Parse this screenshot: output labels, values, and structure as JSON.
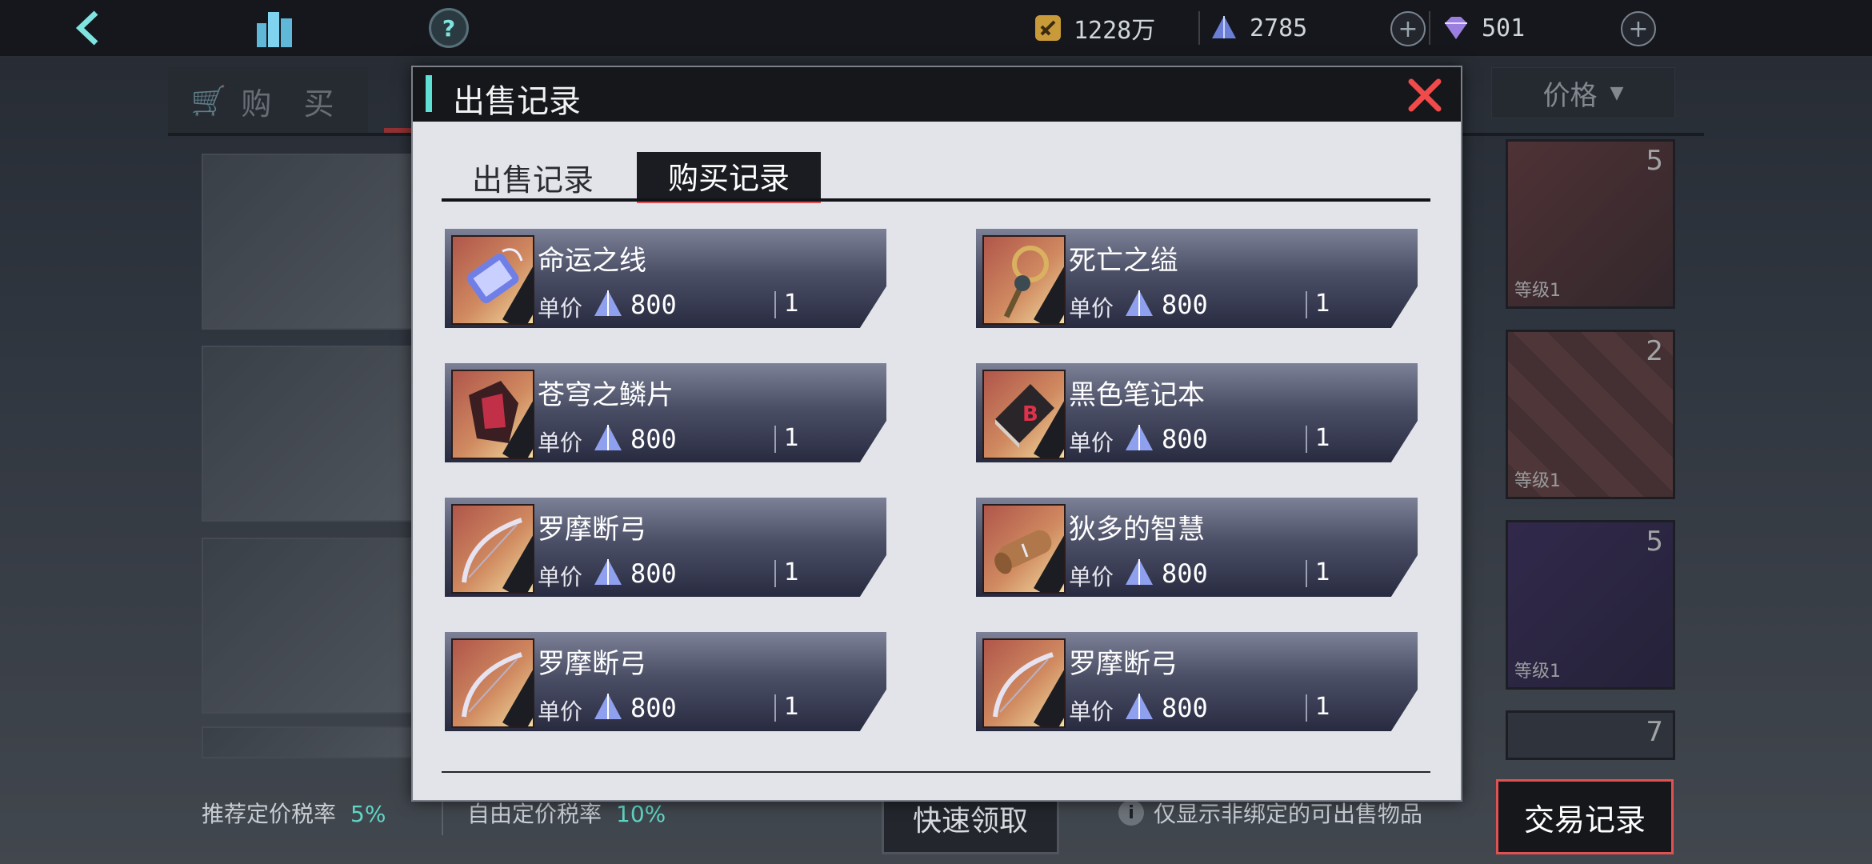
{
  "currencies": {
    "gold": "1228万",
    "crystal": "2785",
    "gem": "501"
  },
  "background": {
    "buy_tab": "购 买",
    "price_sort": "价格",
    "right_cards": [
      {
        "count": "5",
        "level": "等级1"
      },
      {
        "count": "2",
        "level": "等级1"
      },
      {
        "count": "5",
        "level": "等级1"
      },
      {
        "count": "7",
        "level": ""
      }
    ],
    "recommended_tax_label": "推荐定价税率",
    "recommended_tax_value": "5%",
    "free_tax_label": "自由定价税率",
    "free_tax_value": "10%",
    "quick_claim": "快速领取",
    "note": "仅显示非绑定的可出售物品",
    "trade_records": "交易记录"
  },
  "modal": {
    "title": "出售记录",
    "tabs": [
      {
        "label": "出售记录",
        "active": false
      },
      {
        "label": "购买记录",
        "active": true
      }
    ],
    "price_label": "单价",
    "records": [
      {
        "name": "命运之线",
        "price": "800",
        "qty": "1",
        "icon": "thread-spool-icon"
      },
      {
        "name": "死亡之缢",
        "price": "800",
        "qty": "1",
        "icon": "noose-icon"
      },
      {
        "name": "苍穹之鳞片",
        "price": "800",
        "qty": "1",
        "icon": "scale-shard-icon"
      },
      {
        "name": "黑色笔记本",
        "price": "800",
        "qty": "1",
        "icon": "black-notebook-icon"
      },
      {
        "name": "罗摩断弓",
        "price": "800",
        "qty": "1",
        "icon": "broken-bow-icon"
      },
      {
        "name": "狄多的智慧",
        "price": "800",
        "qty": "1",
        "icon": "scroll-icon"
      },
      {
        "name": "罗摩断弓",
        "price": "800",
        "qty": "1",
        "icon": "broken-bow-icon"
      },
      {
        "name": "罗摩断弓",
        "price": "800",
        "qty": "1",
        "icon": "broken-bow-icon"
      }
    ]
  }
}
